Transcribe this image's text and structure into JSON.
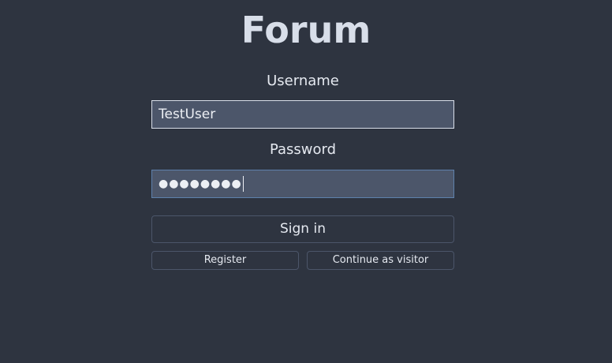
{
  "app": {
    "title": "Forum"
  },
  "login": {
    "username_label": "Username",
    "username_value": "TestUser",
    "password_label": "Password",
    "password_value_masked": "●●●●●●●●"
  },
  "actions": {
    "sign_in_label": "Sign in",
    "register_label": "Register",
    "visitor_label": "Continue as visitor"
  },
  "colors": {
    "background": "#2e3440",
    "field_background": "#4c566a",
    "focus_border": "#5e81ac",
    "text": "#d8dee9"
  }
}
